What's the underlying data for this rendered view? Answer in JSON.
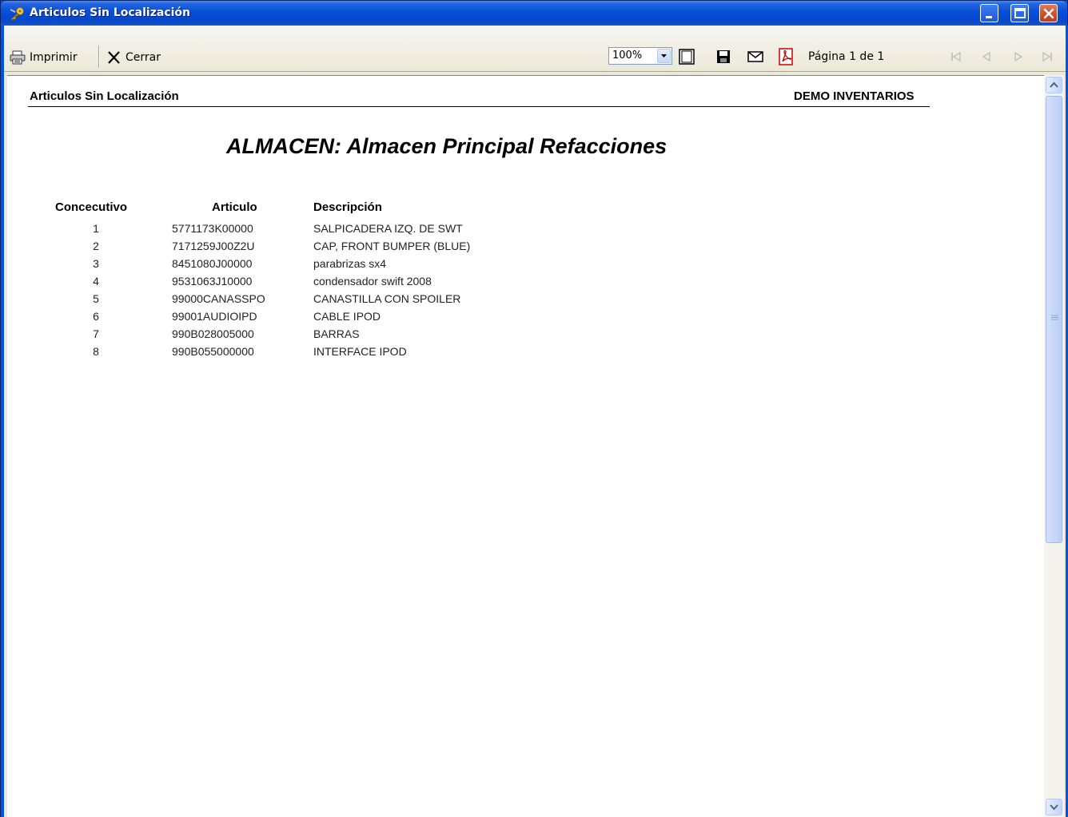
{
  "window": {
    "title": "Articulos Sin Localización"
  },
  "toolbar": {
    "print_label": "Imprimir",
    "close_label": "Cerrar",
    "zoom_value": "100%",
    "page_label": "Página 1 de 1"
  },
  "report": {
    "header_left": "Articulos Sin Localización",
    "header_right": "DEMO INVENTARIOS",
    "title": "ALMACEN: Almacen Principal Refacciones",
    "columns": {
      "num": "Concecutivo",
      "art": "Articulo",
      "desc": "Descripción"
    },
    "rows": [
      {
        "num": "1",
        "art": "5771173K00000",
        "desc": "SALPICADERA IZQ. DE SWT"
      },
      {
        "num": "2",
        "art": "7171259J00Z2U",
        "desc": "CAP, FRONT BUMPER (BLUE)"
      },
      {
        "num": "3",
        "art": "8451080J00000",
        "desc": "parabrizas sx4"
      },
      {
        "num": "4",
        "art": "9531063J10000",
        "desc": "condensador swift 2008"
      },
      {
        "num": "5",
        "art": "99000CANASSPO",
        "desc": "CANASTILLA CON SPOILER"
      },
      {
        "num": "6",
        "art": "99001AUDIOIPD",
        "desc": "CABLE IPOD"
      },
      {
        "num": "7",
        "art": "990B028005000",
        "desc": "BARRAS"
      },
      {
        "num": "8",
        "art": "990B055000000",
        "desc": "INTERFACE IPOD"
      }
    ]
  },
  "colors": {
    "titlebar": "#0A4FD8",
    "window_bg": "#ECE9D8",
    "close_button": "#D5502C"
  },
  "icons": {
    "app": "key-icon",
    "print": "printer-icon",
    "close": "x-icon",
    "fit": "page-frame-icon",
    "save": "floppy-disk-icon",
    "email": "envelope-icon",
    "pdf": "pdf-icon"
  }
}
